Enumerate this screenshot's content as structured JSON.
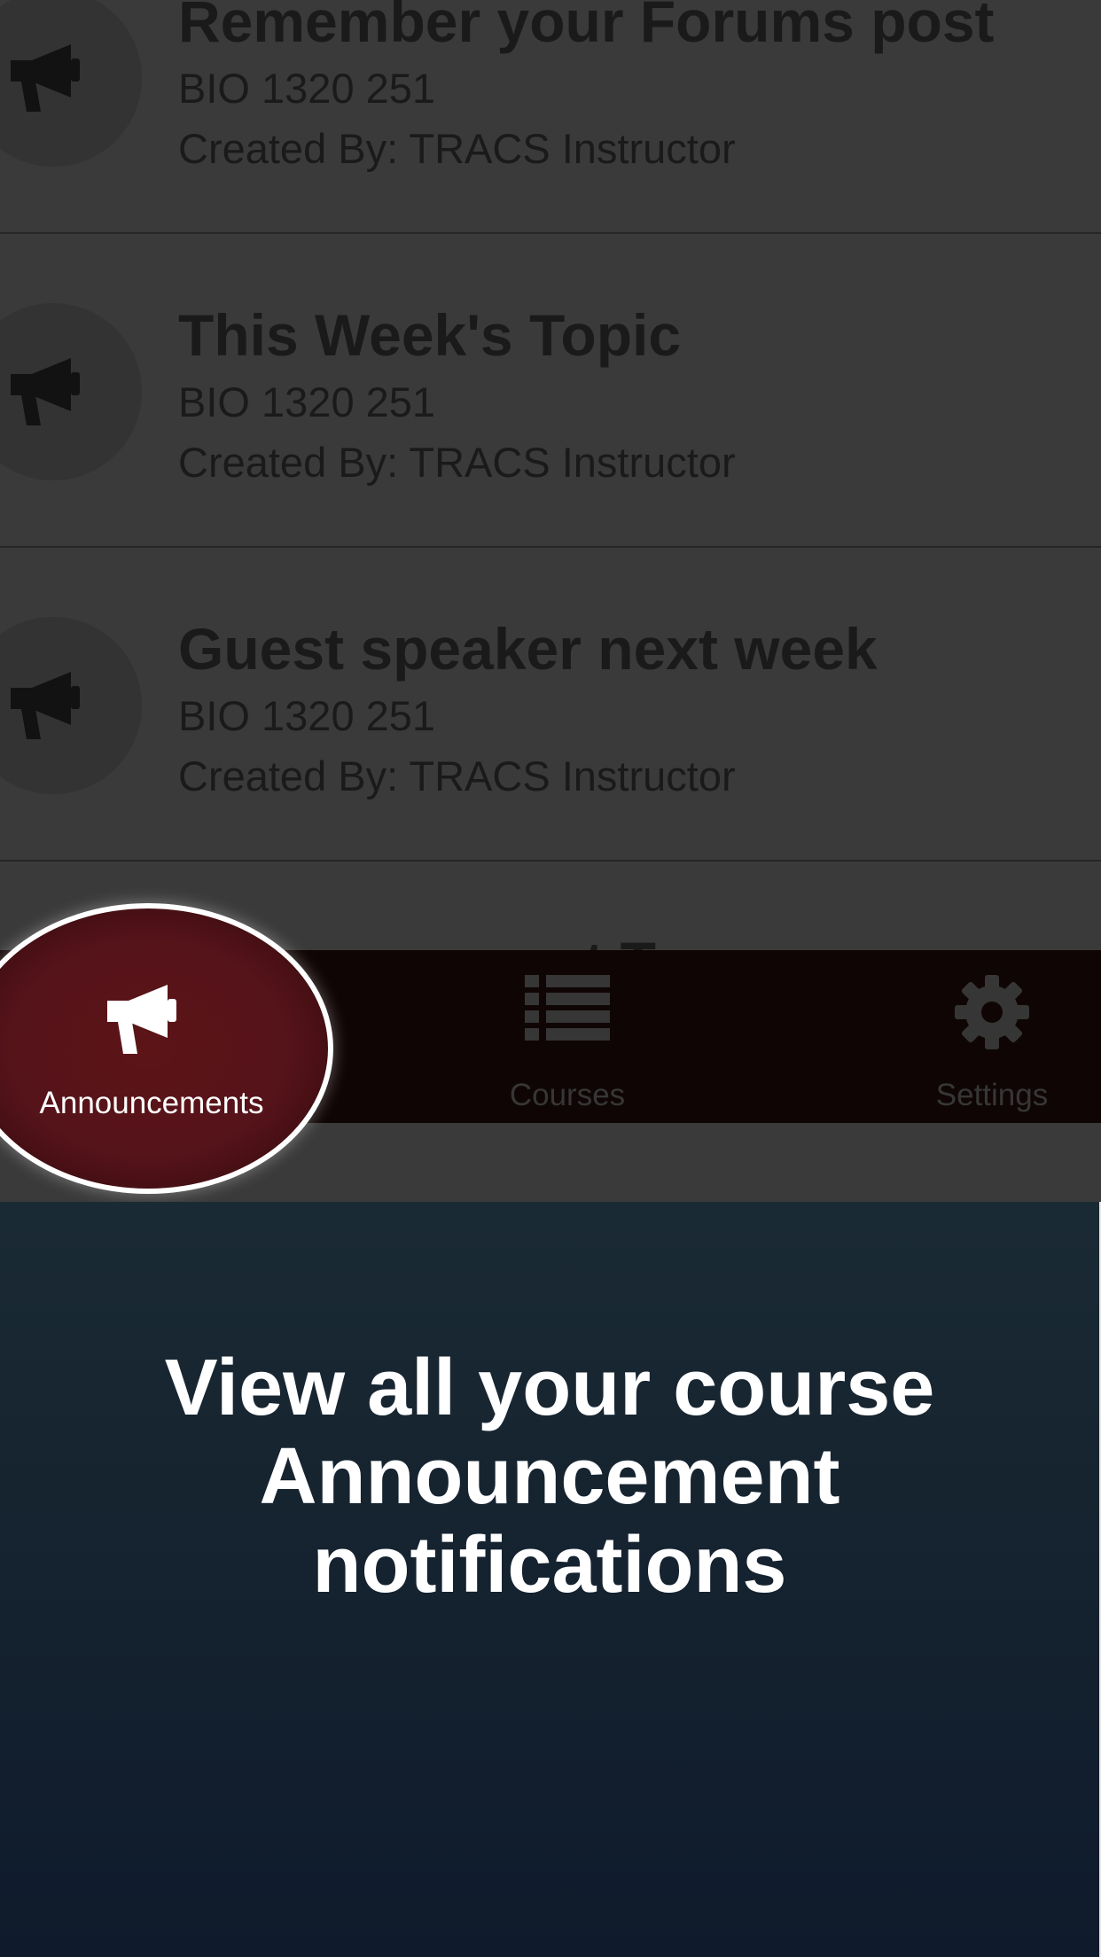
{
  "announcements": [
    {
      "title": "Remember your Forums post",
      "course": "BIO 1320 251",
      "creator": "Created By: TRACS Instructor"
    },
    {
      "title": "This Week's Topic",
      "course": "BIO 1320 251",
      "creator": "Created By: TRACS Instructor"
    },
    {
      "title": "Guest speaker next week",
      "course": "BIO 1320 251",
      "creator": "Created By: TRACS Instructor"
    },
    {
      "title": "Announcement Two",
      "course": "",
      "creator": ""
    }
  ],
  "tabbar": {
    "announcements_label": "Announcements",
    "courses_label": "Courses",
    "settings_label": "Settings",
    "active_tab": "Announcements",
    "icons": {
      "announcements": "megaphone-icon",
      "courses": "list-icon",
      "settings": "gear-icon"
    }
  },
  "tutorial": {
    "message": "View all your course Announcement notifications"
  },
  "colors": {
    "accent": "#5c1417",
    "panel_bg": "#15222f",
    "tabbar_bg": "#100505"
  }
}
